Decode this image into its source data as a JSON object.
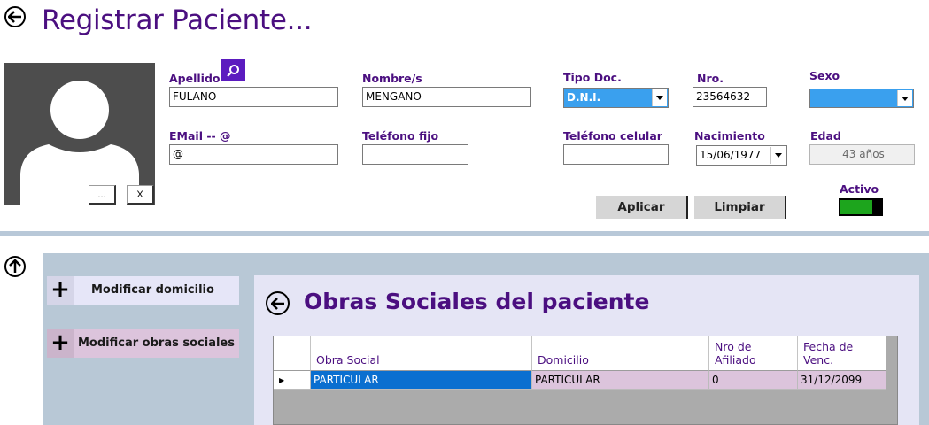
{
  "page": {
    "title": "Registrar Paciente..."
  },
  "photo": {
    "browse_label": "...",
    "clear_label": "X"
  },
  "form": {
    "apellido": {
      "label": "Apellido",
      "value": "FULANO"
    },
    "nombre": {
      "label": "Nombre/s",
      "value": "MENGANO"
    },
    "tipo_doc": {
      "label": "Tipo Doc.",
      "value": "D.N.I."
    },
    "nro": {
      "label": "Nro.",
      "value": "23564632"
    },
    "sexo": {
      "label": "Sexo",
      "value": ""
    },
    "email": {
      "label": "EMail -- @",
      "value": "@"
    },
    "telefono_fijo": {
      "label": "Teléfono fijo",
      "value": ""
    },
    "telefono_celular": {
      "label": "Teléfono celular",
      "value": ""
    },
    "nacimiento": {
      "label": "Nacimiento",
      "value": "15/06/1977"
    },
    "edad": {
      "label": "Edad",
      "value": "43 años"
    },
    "activo": {
      "label": "Activo",
      "on": true
    }
  },
  "buttons": {
    "aplicar": "Aplicar",
    "limpiar": "Limpiar"
  },
  "side_menu": [
    {
      "plus": "+",
      "label": "Modificar domicilio"
    },
    {
      "plus": "+",
      "label": "Modificar obras sociales"
    }
  ],
  "obras_sociales": {
    "title": "Obras Sociales del paciente",
    "columns": [
      "Obra Social",
      "Domicilio",
      "Nro de Afiliado",
      "Fecha de Venc."
    ],
    "rows": [
      {
        "indicator": "▶",
        "obra_social": "PARTICULAR",
        "domicilio": "PARTICULAR",
        "nro_afiliado": "0",
        "fecha_venc": "31/12/2099"
      }
    ]
  },
  "colors": {
    "title": "#4b0f80",
    "search_button": "#5b1bbf",
    "toggle_on": "#1da51d",
    "selected_cell": "#0a6fd0",
    "row": "#dcc4dc",
    "tipo_doc_bg": "#3aa0ee"
  }
}
